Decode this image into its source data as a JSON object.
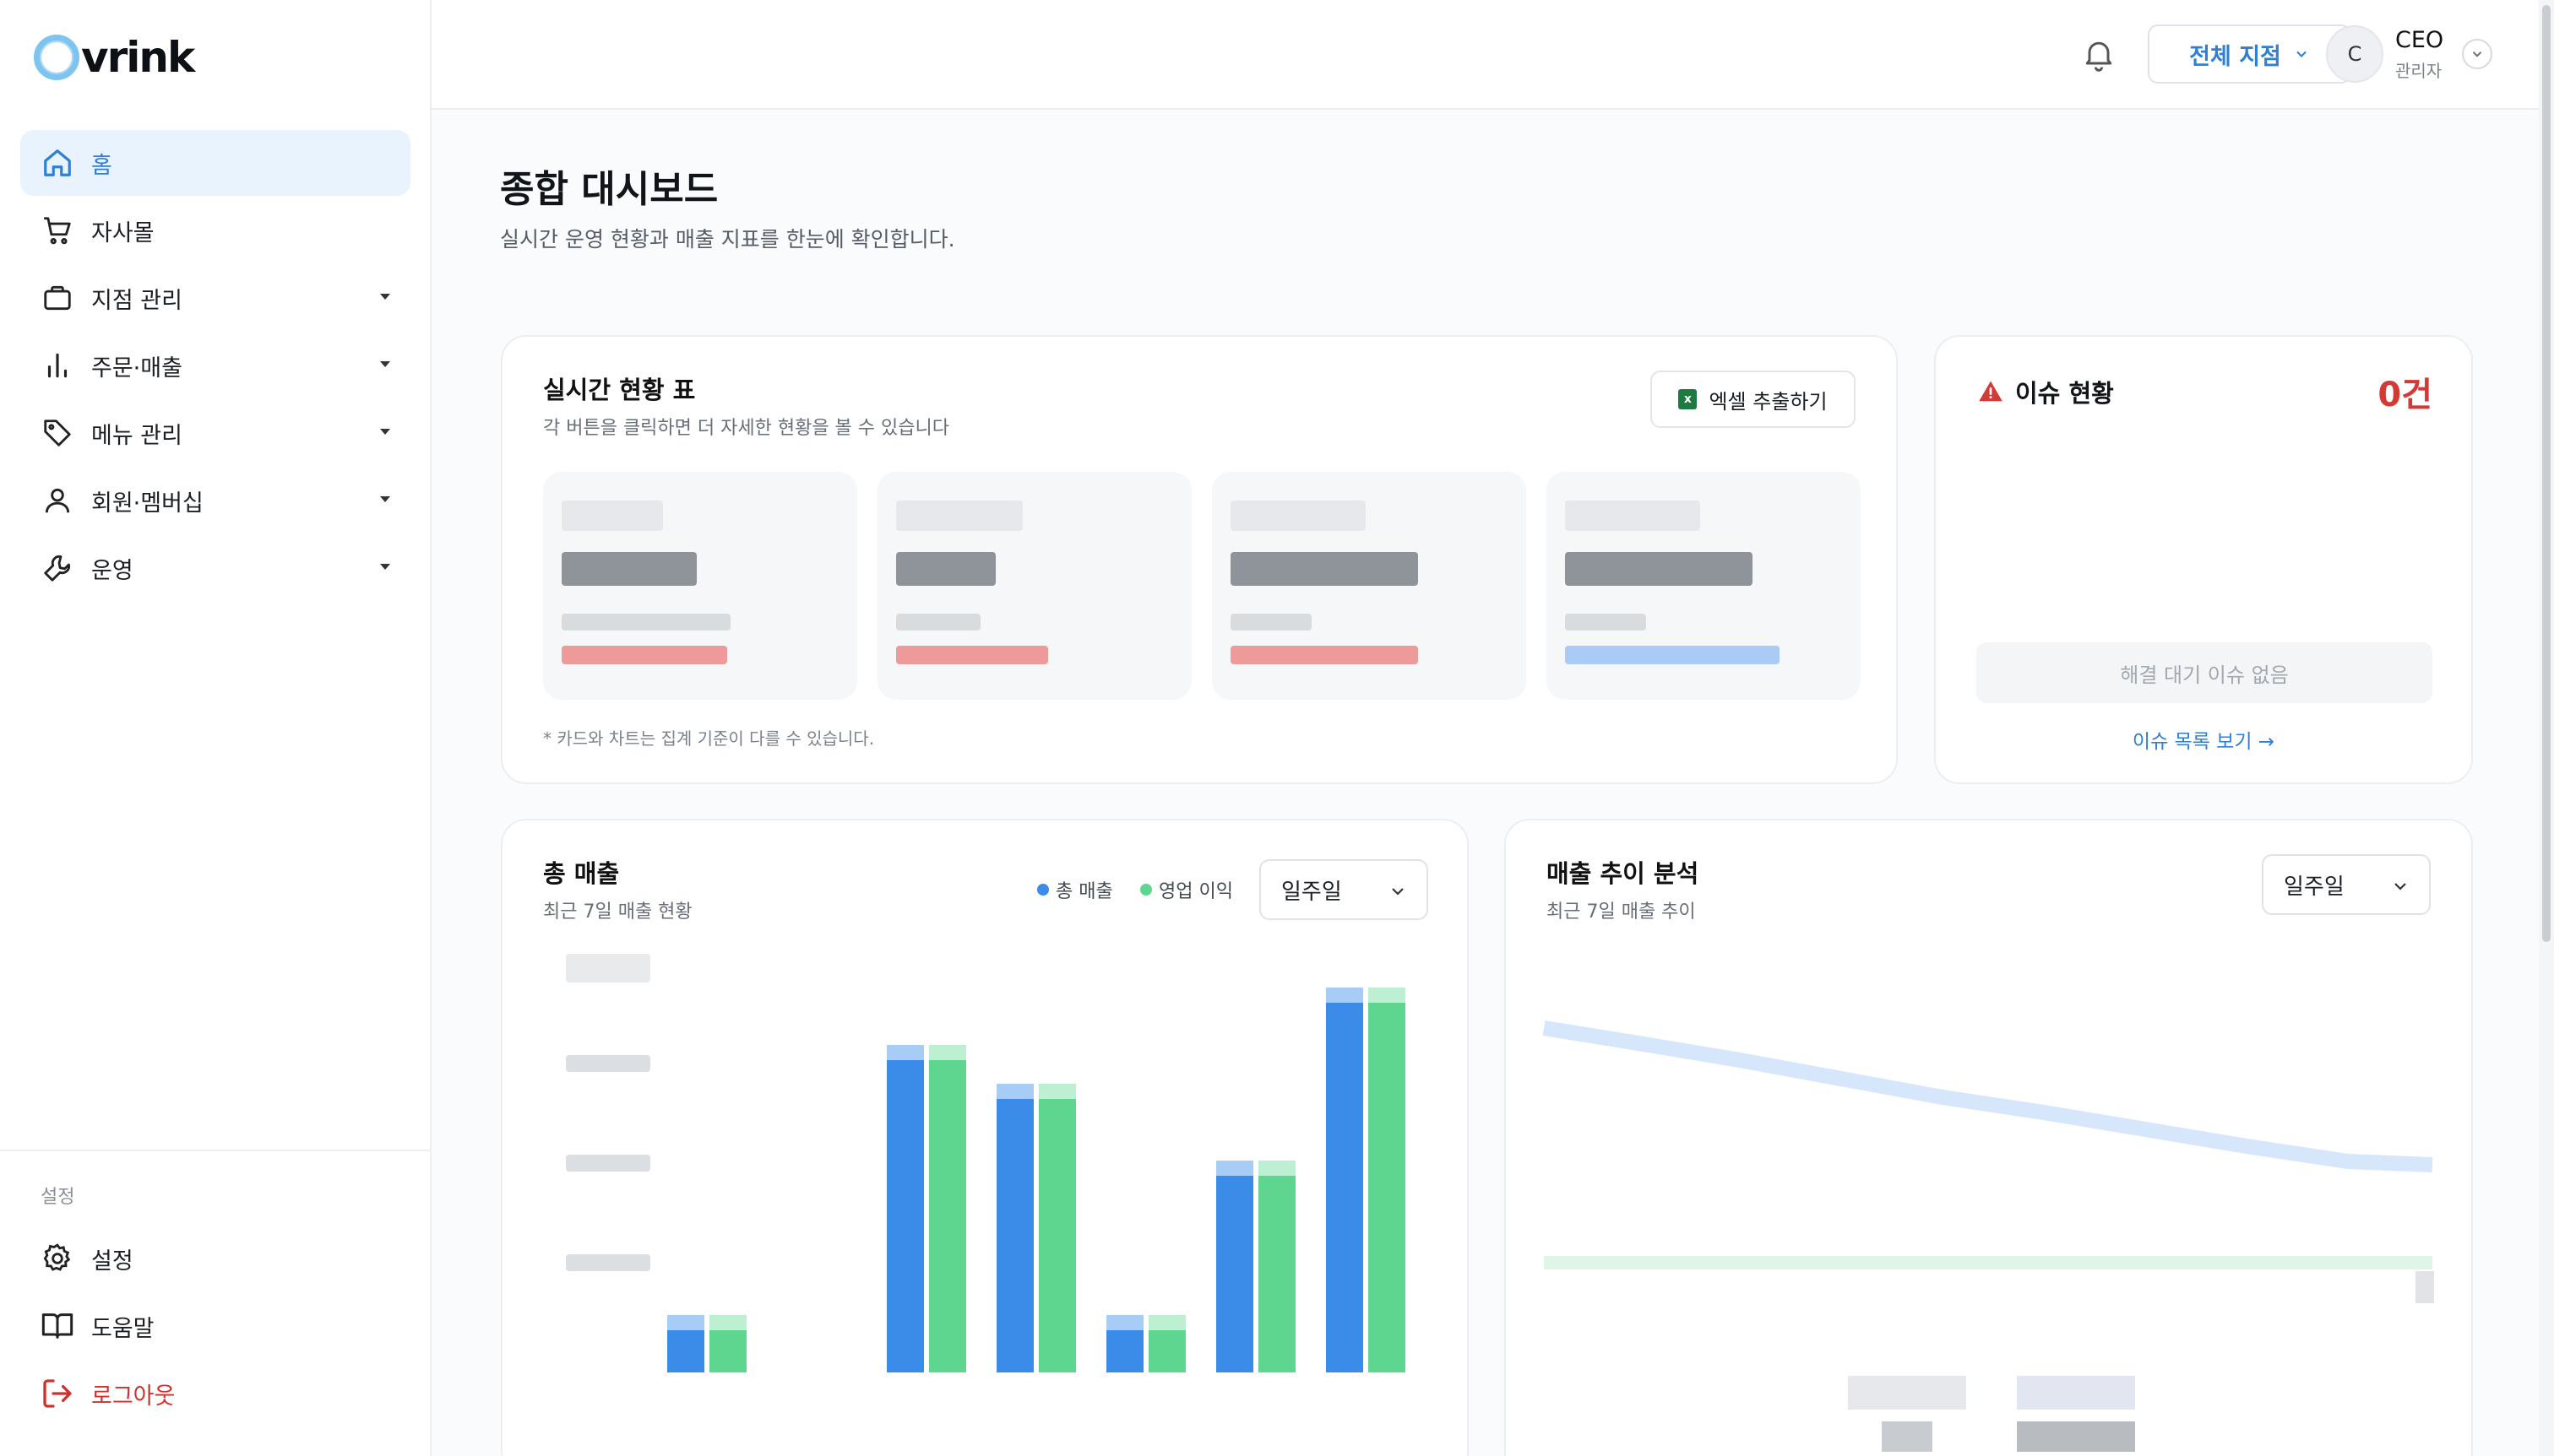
{
  "app": {
    "logo_text": "vrink"
  },
  "sidebar": {
    "items": [
      {
        "label": "홈",
        "icon": "home-icon",
        "active": true
      },
      {
        "label": "자사몰",
        "icon": "cart-icon"
      },
      {
        "label": "지점 관리",
        "icon": "briefcase-icon",
        "expandable": true
      },
      {
        "label": "주문·매출",
        "icon": "bar-chart-icon",
        "expandable": true
      },
      {
        "label": "메뉴 관리",
        "icon": "tag-icon",
        "expandable": true
      },
      {
        "label": "회원·멤버십",
        "icon": "user-icon",
        "expandable": true
      },
      {
        "label": "운영",
        "icon": "wrench-icon",
        "expandable": true
      }
    ],
    "settings_section_label": "설정",
    "bottom_items": [
      {
        "label": "설정",
        "icon": "gear-icon"
      },
      {
        "label": "도움말",
        "icon": "book-icon"
      },
      {
        "label": "로그아웃",
        "icon": "logout-icon"
      }
    ]
  },
  "topbar": {
    "branch_select": "전체 지점",
    "user": {
      "avatar_initial": "C",
      "name": "CEO",
      "role": "관리자"
    }
  },
  "page": {
    "title": "종합 대시보드",
    "subtitle": "실시간 운영 현황과 매출 지표를 한눈에 확인합니다."
  },
  "realtime": {
    "title": "실시간 현황 표",
    "subtitle": "각 버튼을 클릭하면 더 자세한 현황을 볼 수 있습니다",
    "export_label": "엑셀 추출하기",
    "note": "* 카드와 차트는 집계 기준이 다를 수 있습니다."
  },
  "issues": {
    "title": "이슈 현황",
    "count": "0건",
    "empty_text": "해결 대기 이슈 없음",
    "link": "이슈 목록 보기 →"
  },
  "sales": {
    "title": "총 매출",
    "subtitle": "최근 7일 매출 현황",
    "legend": [
      {
        "label": "총 매출",
        "color": "#3b8be8"
      },
      {
        "label": "영업 이익",
        "color": "#5fd68f"
      }
    ],
    "period": "일주일"
  },
  "trend": {
    "title": "매출 추이 분석",
    "subtitle": "최근 7일 매출 추이",
    "period": "일주일"
  },
  "colors": {
    "accent": "#2f7fd3",
    "danger": "#d23a35",
    "sales": "#3b8be8",
    "profit": "#5fd68f"
  },
  "chart_data": [
    {
      "type": "bar",
      "series": [
        {
          "name": "총 매출",
          "values": [
            0.15,
            0,
            0.85,
            0.75,
            0.15,
            0.55,
            1.0
          ]
        },
        {
          "name": "영업 이익",
          "values": [
            0.15,
            0,
            0.85,
            0.75,
            0.15,
            0.55,
            1.0
          ]
        }
      ]
    }
  ]
}
